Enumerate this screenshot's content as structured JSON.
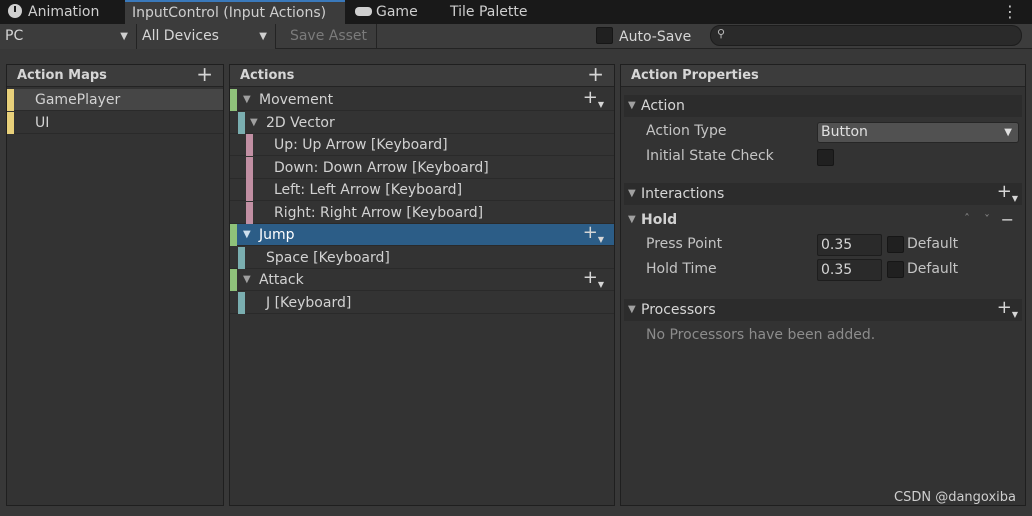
{
  "tabs": [
    {
      "label": "Animation",
      "icon": "clock-icon"
    },
    {
      "label": "InputControl (Input Actions)",
      "active": true
    },
    {
      "label": "Game",
      "icon": "gamepad-icon"
    },
    {
      "label": "Tile Palette"
    }
  ],
  "toolbar": {
    "scheme": "PC",
    "devices": "All Devices",
    "save_asset": "Save Asset",
    "auto_save": "Auto-Save",
    "search_value": ""
  },
  "action_maps": {
    "title": "Action Maps",
    "items": [
      {
        "label": "GamePlayer",
        "selected": true
      },
      {
        "label": "UI",
        "selected": false
      }
    ]
  },
  "actions": {
    "title": "Actions",
    "rows": [
      {
        "label": "Movement",
        "kind": "action",
        "color": "#8fc27a"
      },
      {
        "label": "2D Vector",
        "kind": "composite",
        "color": "#7aaeb0"
      },
      {
        "label": "Up: Up Arrow [Keyboard]",
        "kind": "part",
        "color": "#c18fa3"
      },
      {
        "label": "Down: Down Arrow [Keyboard]",
        "kind": "part",
        "color": "#c18fa3"
      },
      {
        "label": "Left: Left Arrow [Keyboard]",
        "kind": "part",
        "color": "#c18fa3"
      },
      {
        "label": "Right: Right Arrow [Keyboard]",
        "kind": "part",
        "color": "#c18fa3"
      },
      {
        "label": "Jump",
        "kind": "action",
        "color": "#8fc27a",
        "selected": true
      },
      {
        "label": "Space [Keyboard]",
        "kind": "binding",
        "color": "#7aaeb0"
      },
      {
        "label": "Attack",
        "kind": "action",
        "color": "#8fc27a"
      },
      {
        "label": "J [Keyboard]",
        "kind": "binding",
        "color": "#7aaeb0"
      }
    ]
  },
  "properties": {
    "title": "Action Properties",
    "action_section": "Action",
    "action_type_label": "Action Type",
    "action_type_value": "Button",
    "initial_state_label": "Initial State Check",
    "interactions_section": "Interactions",
    "hold_label": "Hold",
    "press_point_label": "Press Point",
    "press_point_value": "0.35",
    "hold_time_label": "Hold Time",
    "hold_time_value": "0.35",
    "default_label": "Default",
    "processors_section": "Processors",
    "no_processors": "No Processors have been added."
  },
  "watermark": "CSDN @dangoxiba",
  "colors": {
    "selected_row": "#2c5d87",
    "accent": "#3a79bb",
    "map_bar": "#e8d07a"
  }
}
